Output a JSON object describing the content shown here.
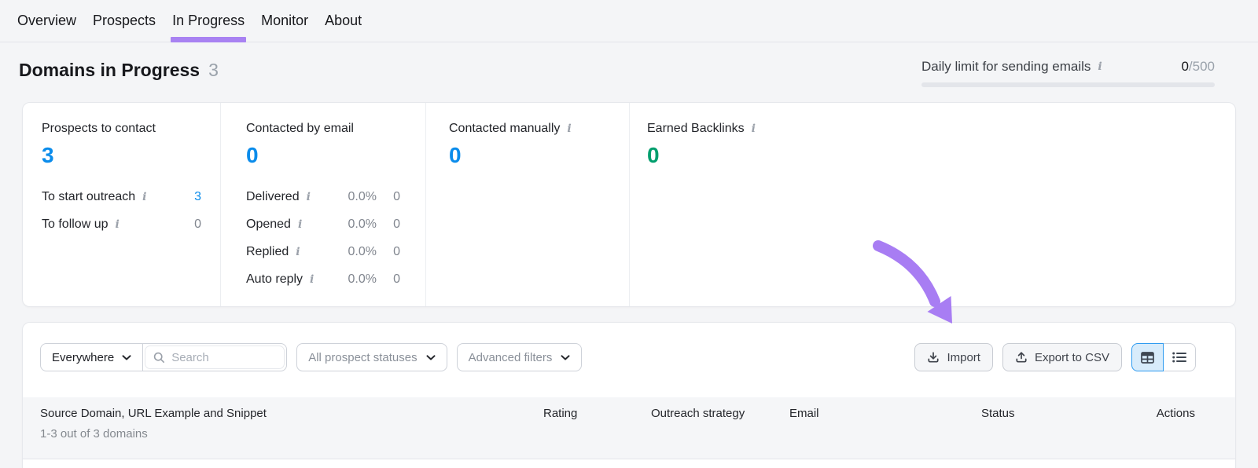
{
  "colors": {
    "accent_purple": "#a87df3",
    "accent_blue": "#0b8ceb",
    "accent_green": "#009e6d",
    "selected_toggle_bg": "#d8ecfb",
    "selected_toggle_border": "#2e9bf0"
  },
  "nav": {
    "tabs": [
      "Overview",
      "Prospects",
      "In Progress",
      "Monitor",
      "About"
    ],
    "active_tab": "In Progress"
  },
  "header": {
    "title": "Domains in Progress",
    "count": "3"
  },
  "daily_limit": {
    "label": "Daily limit for sending emails",
    "used": "0",
    "total": "/500"
  },
  "stats": {
    "col1": {
      "title": "Prospects to contact",
      "value": "3",
      "rows": [
        {
          "label": "To start outreach",
          "value": "3"
        },
        {
          "label": "To follow up",
          "value": "0"
        }
      ]
    },
    "col2": {
      "title": "Contacted by email",
      "value": "0",
      "rows": [
        {
          "label": "Delivered",
          "pct": "0.0%",
          "count": "0"
        },
        {
          "label": "Opened",
          "pct": "0.0%",
          "count": "0"
        },
        {
          "label": "Replied",
          "pct": "0.0%",
          "count": "0"
        },
        {
          "label": "Auto reply",
          "pct": "0.0%",
          "count": "0"
        }
      ]
    },
    "col3": {
      "title": "Contacted manually",
      "value": "0"
    },
    "col4": {
      "title": "Earned Backlinks",
      "value": "0"
    }
  },
  "toolbar": {
    "scope": "Everywhere",
    "search_placeholder": "Search",
    "status_filter": "All prospect statuses",
    "advanced_filters": "Advanced filters",
    "import_label": "Import",
    "export_label": "Export to CSV"
  },
  "table": {
    "summary": "1-3 out of 3 domains",
    "columns": [
      "Source Domain, URL Example and Snippet",
      "Rating",
      "Outreach strategy",
      "Email",
      "Status",
      "Actions"
    ]
  },
  "icons": {
    "info": "i"
  }
}
